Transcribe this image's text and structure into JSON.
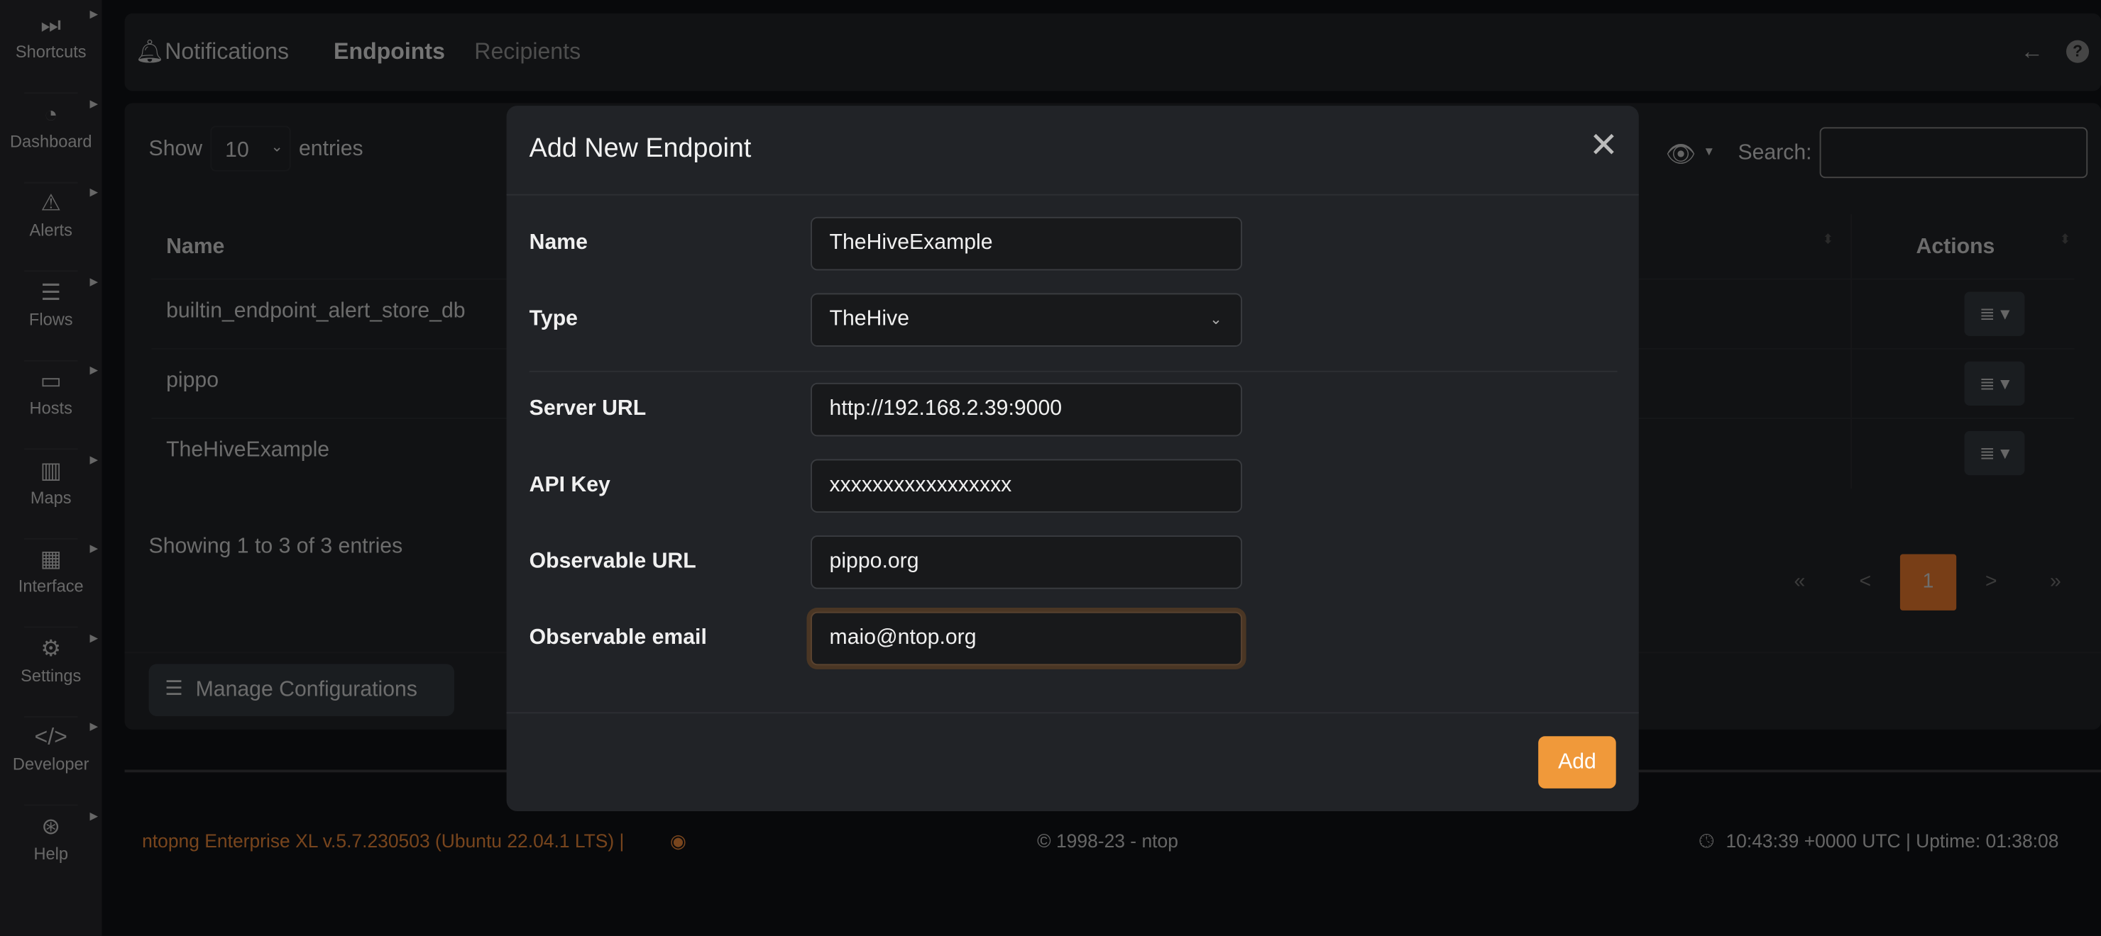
{
  "sidebar": {
    "items": [
      {
        "label": "Shortcuts",
        "icon": "forward-icon",
        "glyph": "⏭"
      },
      {
        "label": "Dashboard",
        "icon": "gauge-icon",
        "glyph": "◔"
      },
      {
        "label": "Alerts",
        "icon": "warning-icon",
        "glyph": "⚠"
      },
      {
        "label": "Flows",
        "icon": "list-icon",
        "glyph": "☰"
      },
      {
        "label": "Hosts",
        "icon": "laptop-icon",
        "glyph": "▭"
      },
      {
        "label": "Maps",
        "icon": "map-icon",
        "glyph": "▥"
      },
      {
        "label": "Interface",
        "icon": "ethernet-icon",
        "glyph": "▦"
      },
      {
        "label": "Settings",
        "icon": "gear-icon",
        "glyph": "⚙"
      },
      {
        "label": "Developer",
        "icon": "code-icon",
        "glyph": "</>"
      },
      {
        "label": "Help",
        "icon": "lifebuoy-icon",
        "glyph": "⊛"
      }
    ]
  },
  "header": {
    "title": "Notifications",
    "tabs": [
      "Endpoints",
      "Recipients"
    ],
    "active_tab": "Endpoints"
  },
  "table": {
    "show_label": "Show",
    "entries_value": "10",
    "entries_label": "entries",
    "search_label": "Search:",
    "search_value": "",
    "columns": [
      "Name",
      "Actions"
    ],
    "rows": [
      "builtin_endpoint_alert_store_db",
      "pippo",
      "TheHiveExample"
    ],
    "info": "Showing 1 to 3 of 3 entries",
    "pagination": {
      "first": "«",
      "prev": "<",
      "current": "1",
      "next": ">",
      "last": "»"
    },
    "manage_button": "Manage Configurations"
  },
  "modal": {
    "title": "Add New Endpoint",
    "fields": [
      {
        "label": "Name",
        "value": "TheHiveExample"
      },
      {
        "label": "Type",
        "value": "TheHive"
      },
      {
        "label": "Server URL",
        "value": "http://192.168.2.39:9000"
      },
      {
        "label": "API Key",
        "value": "xxxxxxxxxxxxxxxxx"
      },
      {
        "label": "Observable URL",
        "value": "pippo.org"
      },
      {
        "label": "Observable email",
        "value": "maio@ntop.org"
      }
    ],
    "add_button": "Add"
  },
  "footer": {
    "version": "ntopng Enterprise XL v.5.7.230503 (Ubuntu 22.04.1 LTS) |",
    "copyright": "© 1998-23 - ntop",
    "time": "10:43:39 +0000 UTC | Uptime: 01:38:08"
  },
  "colors": {
    "accent": "#f0993a",
    "active_page": "#f07c2e",
    "version_text": "#f08a3a"
  }
}
